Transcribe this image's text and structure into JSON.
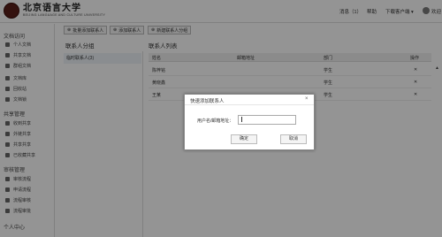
{
  "header": {
    "logo_cn": "北京语言大学",
    "logo_en": "BEIJING LANGUAGE AND CULTURE UNIVERSITY",
    "messages": "消息（1）",
    "help": "帮助",
    "download_client": "下载客户端 ▾",
    "user_label": "欢迎"
  },
  "sidebar": {
    "sections": [
      {
        "title": "文档访问",
        "items": [
          "个人文档",
          "共享文档",
          "群组文档"
        ]
      },
      {
        "title": "",
        "items": [
          "文档库",
          "回收站",
          "文档锁"
        ]
      },
      {
        "title": "共享管理",
        "items": [
          "收到共享",
          "外链共享",
          "共享共享",
          "已收藏共享"
        ]
      },
      {
        "title": "审核管理",
        "items": [
          "审核流程",
          "申请流程",
          "流程审核",
          "流程审批"
        ]
      },
      {
        "title": "个人中心",
        "items": []
      }
    ]
  },
  "toolbar": {
    "batch_add": "批量添加联系人",
    "add_contact": "添加联系人",
    "new_group": "新建联系人分组"
  },
  "groups_panel": {
    "title": "联系人分组",
    "items": [
      "临时联系人(3)"
    ]
  },
  "contacts_panel": {
    "title": "联系人列表",
    "columns": [
      "姓名",
      "邮箱地址",
      "部门",
      "操作"
    ],
    "rows": [
      {
        "name": "陈梓铭",
        "email": "",
        "dept": "学生",
        "action": "✕"
      },
      {
        "name": "黄晓鑫",
        "email": "",
        "dept": "学生",
        "action": "✕"
      },
      {
        "name": "王某",
        "email": "",
        "dept": "学生",
        "action": "✕"
      }
    ]
  },
  "dialog": {
    "title": "快速添加联系人",
    "close": "×",
    "field_label": "用户名/邮箱地址：",
    "input_value": "",
    "ok": "确定",
    "cancel": "取消"
  },
  "colors": {
    "overlay": "rgba(0,0,0,0.42)",
    "accent_brand": "#5a1f1a"
  }
}
